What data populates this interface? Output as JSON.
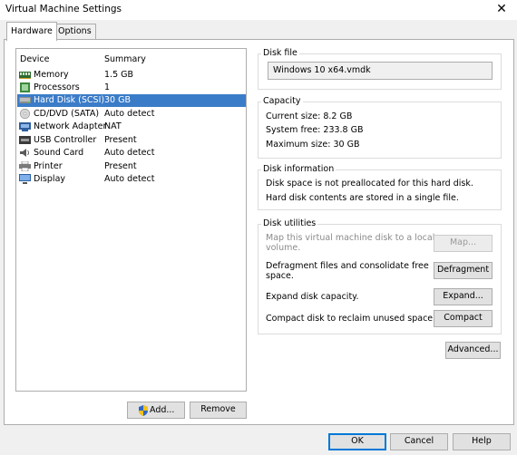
{
  "window": {
    "title": "Virtual Machine Settings"
  },
  "tabs": [
    {
      "label": "Hardware"
    },
    {
      "label": "Options"
    }
  ],
  "device_list": {
    "columns": [
      "Device",
      "Summary"
    ],
    "rows": [
      {
        "name": "Memory",
        "summary": "1.5 GB",
        "icon": "memory-icon"
      },
      {
        "name": "Processors",
        "summary": "1",
        "icon": "processor-icon"
      },
      {
        "name": "Hard Disk (SCSI)",
        "summary": "30 GB",
        "icon": "hard-disk-icon"
      },
      {
        "name": "CD/DVD (SATA)",
        "summary": "Auto detect",
        "icon": "cd-dvd-icon"
      },
      {
        "name": "Network Adapter",
        "summary": "NAT",
        "icon": "network-adapter-icon"
      },
      {
        "name": "USB Controller",
        "summary": "Present",
        "icon": "usb-icon"
      },
      {
        "name": "Sound Card",
        "summary": "Auto detect",
        "icon": "sound-card-icon"
      },
      {
        "name": "Printer",
        "summary": "Present",
        "icon": "printer-icon"
      },
      {
        "name": "Display",
        "summary": "Auto detect",
        "icon": "display-icon"
      }
    ],
    "selected": "Hard Disk (SCSI)",
    "add_label": "Add...",
    "remove_label": "Remove"
  },
  "disk_file": {
    "label": "Disk file",
    "value": "Windows 10 x64.vmdk"
  },
  "capacity": {
    "label": "Capacity",
    "current_size": "Current size: 8.2 GB",
    "system_free": "System free: 233.8 GB",
    "maximum_size": "Maximum size: 30 GB"
  },
  "disk_information": {
    "label": "Disk information",
    "line1": "Disk space is not preallocated for this hard disk.",
    "line2": "Hard disk contents are stored in a single file."
  },
  "disk_utilities": {
    "label": "Disk utilities",
    "map_text_1": "Map this virtual machine disk to a local",
    "map_text_2": "volume.",
    "map_button": "Map...",
    "defrag_text_1": "Defragment files and consolidate free",
    "defrag_text_2": "space.",
    "defrag_button": "Defragment",
    "expand_text": "Expand disk capacity.",
    "expand_button": "Expand...",
    "compact_text": "Compact disk to reclaim unused space.",
    "compact_button": "Compact"
  },
  "advanced_button": "Advanced...",
  "footer": {
    "ok": "OK",
    "cancel": "Cancel",
    "help": "Help"
  },
  "colors": {
    "selection": "#3b7cc8",
    "button_focus_border": "#0078d7"
  }
}
